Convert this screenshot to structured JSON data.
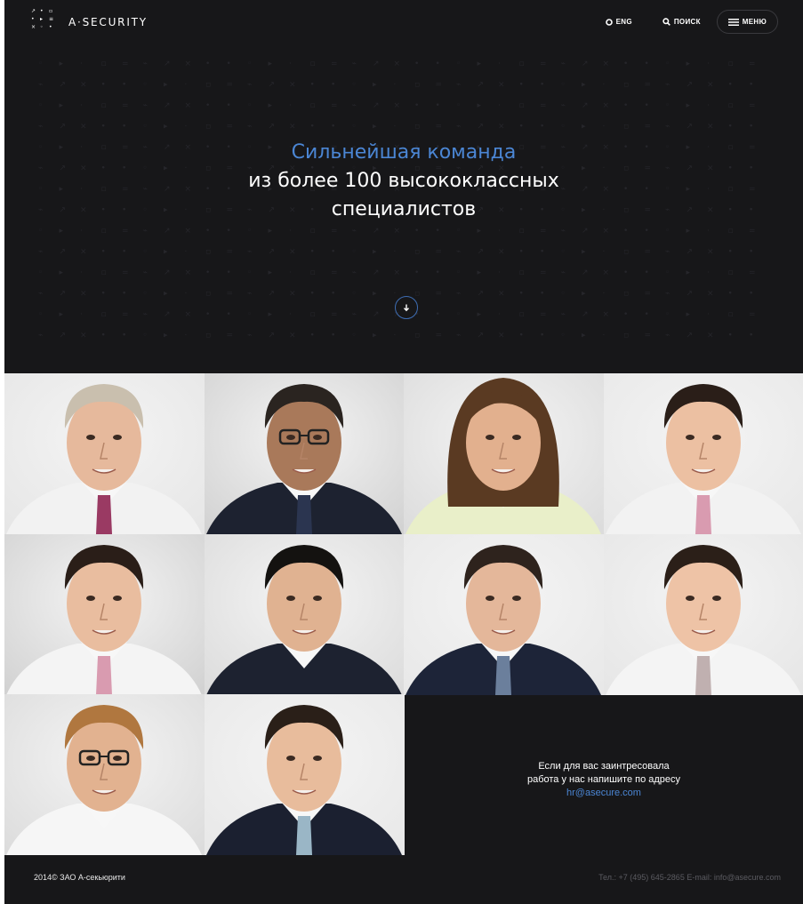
{
  "header": {
    "logo_text": "A·SECURITY",
    "lang_label": "ENG",
    "search_label": "ПОИСК",
    "menu_label": "МЕНЮ"
  },
  "hero": {
    "line1": "Сильнейшая команда",
    "line2": "из более 100 высококлассных",
    "line3": "специалистов"
  },
  "team": {
    "portraits": [
      {
        "hair": "#c9bfae",
        "skin": "#e6b99c",
        "suit": "#f2f2f2",
        "tie": "#9a3a63",
        "glasses": false
      },
      {
        "hair": "#2a2420",
        "skin": "#a9795a",
        "suit": "#1d2230",
        "tie": "#2b3550",
        "glasses": true
      },
      {
        "hair": "#5a3a22",
        "skin": "#e2b08e",
        "suit": "#e9efc9",
        "tie": "",
        "glasses": false
      },
      {
        "hair": "#2a1e18",
        "skin": "#ecc0a2",
        "suit": "#f2f2f2",
        "tie": "#d99bb0",
        "glasses": false
      },
      {
        "hair": "#2a1e18",
        "skin": "#e9bd9f",
        "suit": "#f4f4f4",
        "tie": "#d99bb0",
        "glasses": false
      },
      {
        "hair": "#141210",
        "skin": "#e0b291",
        "suit": "#1d2230",
        "tie": "",
        "glasses": false
      },
      {
        "hair": "#2e231d",
        "skin": "#e4b79a",
        "suit": "#1d2438",
        "tie": "#6b7f9c",
        "glasses": false
      },
      {
        "hair": "#2b1f18",
        "skin": "#eec3a6",
        "suit": "#f4f4f4",
        "tie": "#c0b0b0",
        "glasses": false
      },
      {
        "hair": "#b0773f",
        "skin": "#e2b290",
        "suit": "#f6f6f6",
        "tie": "",
        "glasses": true
      },
      {
        "hair": "#2a1f18",
        "skin": "#e8bc9c",
        "suit": "#1b2030",
        "tie": "#9ab6c6",
        "glasses": false
      }
    ],
    "hr_line1": "Если для вас заинтресовала",
    "hr_line2": "работа у нас  напишите по адресу",
    "hr_email": "hr@asecure.com"
  },
  "footer": {
    "copyright": "2014© ЗАО  А-секьюрити",
    "contacts": "Тел.: +7 (495) 645-2865   E-mail: info@asecure.com"
  },
  "colors": {
    "background": "#171719",
    "accent": "#4b86d4",
    "tile_bg": "#e3e3e3"
  }
}
